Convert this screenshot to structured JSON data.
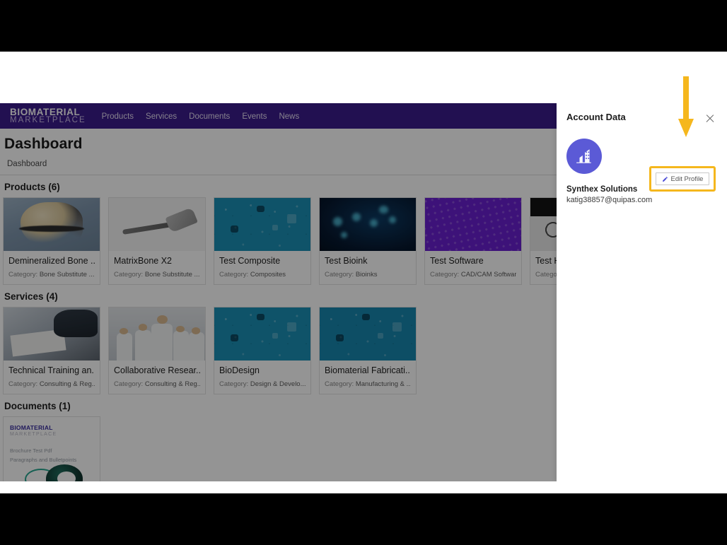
{
  "site": {
    "brand_line1": "BIOMATERIAL",
    "brand_line2": "MARKETPLACE",
    "nav": [
      {
        "label": "Products"
      },
      {
        "label": "Services"
      },
      {
        "label": "Documents"
      },
      {
        "label": "Events"
      },
      {
        "label": "News"
      }
    ]
  },
  "page": {
    "title": "Dashboard",
    "breadcrumb": "Dashboard"
  },
  "sections": {
    "products": {
      "heading": "Products (6)",
      "category_label": "Category:",
      "cards": [
        {
          "title": "Demineralized Bone ...",
          "category": "Bone Substitute ...",
          "art": "img-knee"
        },
        {
          "title": "MatrixBone X2",
          "category": "Bone Substitute ...",
          "art": "img-implant"
        },
        {
          "title": "Test Composite",
          "category": "Composites",
          "art": "img-hex-teal"
        },
        {
          "title": "Test Bioink",
          "category": "Bioinks",
          "art": "img-bioink"
        },
        {
          "title": "Test Software",
          "category": "CAD/CAM Software",
          "art": "img-software"
        },
        {
          "title": "Test H",
          "category": "Categor",
          "art": "img-hand"
        }
      ]
    },
    "services": {
      "heading": "Services (4)",
      "category_label": "Category:",
      "cards": [
        {
          "title": "Technical Training an...",
          "category": "Consulting & Reg...",
          "art": "img-meeting"
        },
        {
          "title": "Collaborative Resear...",
          "category": "Consulting & Reg...",
          "art": "img-team"
        },
        {
          "title": "BioDesign",
          "category": "Design & Develo...",
          "art": "img-hex-teal"
        },
        {
          "title": "Biomaterial Fabricati...",
          "category": "Manufacturing & ...",
          "art": "img-hex-teal2"
        }
      ]
    },
    "documents": {
      "heading": "Documents (1)",
      "cards": [
        {
          "thumb_brand1": "BIOMATERIAL",
          "thumb_brand2": "MARKETPLACE",
          "thumb_line1": "Brochure Test Pdf",
          "thumb_line2": "Paragraphs and Bulletpoints"
        }
      ]
    }
  },
  "account_panel": {
    "title": "Account Data",
    "avatar_icon": "building-icon",
    "name": "Synthex Solutions",
    "email": "katig38857@quipas.com",
    "edit_button": {
      "label": "Edit Profile",
      "icon": "pencil-icon"
    },
    "close_icon": "close-icon"
  },
  "annotation": {
    "arrow_icon": "down-arrow-icon",
    "arrow_color": "#f5b71d",
    "highlight_color": "#f5b71d"
  },
  "colors": {
    "header_purple": "#3b1c8c",
    "avatar_purple": "#5b5ad6",
    "accent_gold": "#f5b71d"
  }
}
